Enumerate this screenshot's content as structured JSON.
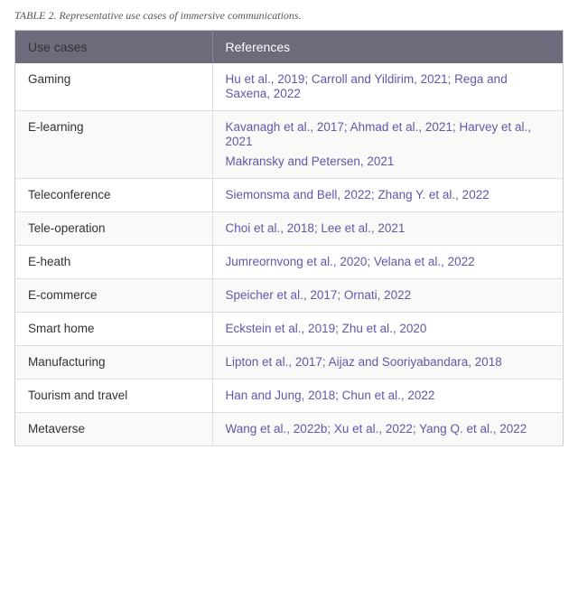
{
  "caption": "TABLE 2. Representative use cases of immersive communications.",
  "header": {
    "col1": "Use cases",
    "col2": "References"
  },
  "rows": [
    {
      "useCase": "Gaming",
      "refGroups": [
        "Hu et al., 2019; Carroll and Yildirim, 2021; Rega and Saxena, 2022"
      ]
    },
    {
      "useCase": "E-learning",
      "refGroups": [
        "Kavanagh et al., 2017; Ahmad et al., 2021; Harvey et al., 2021",
        "Makransky and Petersen, 2021"
      ]
    },
    {
      "useCase": "Teleconference",
      "refGroups": [
        "Siemonsma and Bell, 2022; Zhang Y. et al., 2022"
      ]
    },
    {
      "useCase": "Tele-operation",
      "refGroups": [
        "Choi et al., 2018; Lee et al., 2021"
      ]
    },
    {
      "useCase": "E-heath",
      "refGroups": [
        "Jumreornvong et al., 2020; Velana et al., 2022"
      ]
    },
    {
      "useCase": "E-commerce",
      "refGroups": [
        "Speicher et al., 2017; Ornati, 2022"
      ]
    },
    {
      "useCase": "Smart home",
      "refGroups": [
        "Eckstein et al., 2019; Zhu et al., 2020"
      ]
    },
    {
      "useCase": "Manufacturing",
      "refGroups": [
        "Lipton et al., 2017; Aijaz and Sooriyabandara, 2018"
      ]
    },
    {
      "useCase": "Tourism and travel",
      "refGroups": [
        "Han and Jung, 2018; Chun et al., 2022"
      ]
    },
    {
      "useCase": "Metaverse",
      "refGroups": [
        "Wang et al., 2022b; Xu et al., 2022; Yang Q. et al., 2022"
      ]
    }
  ]
}
